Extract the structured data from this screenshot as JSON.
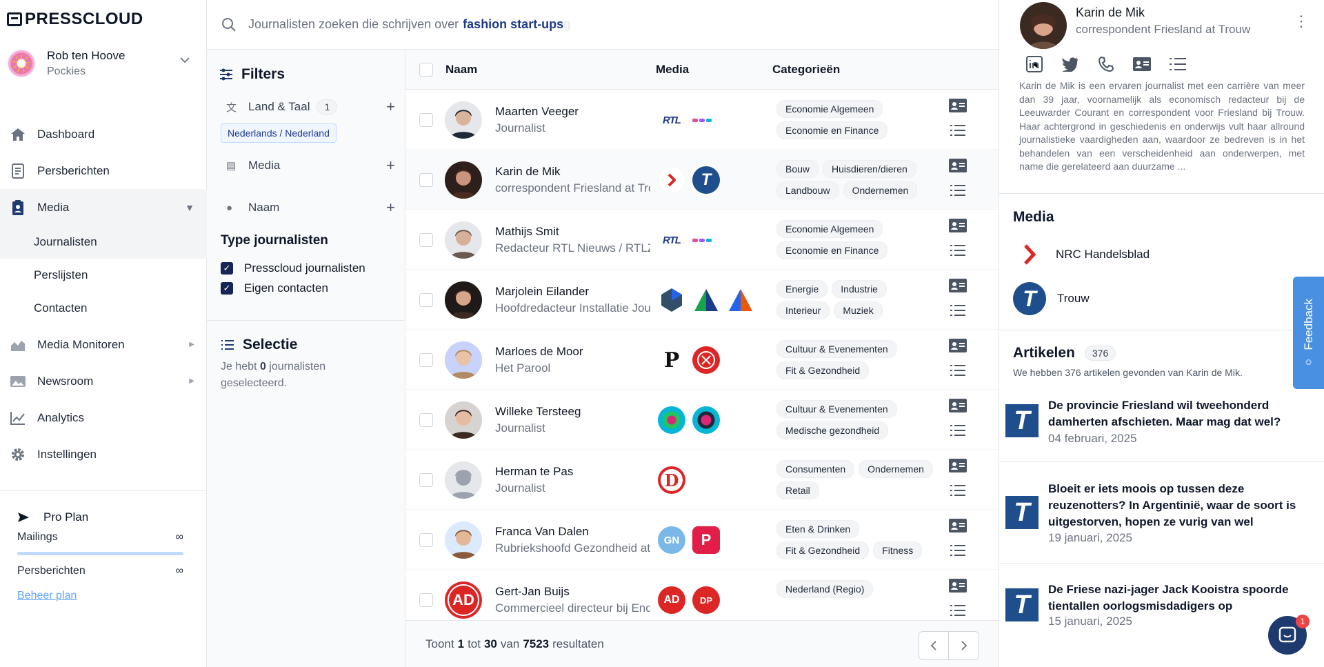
{
  "app": {
    "logo": "PRESSCLOUD"
  },
  "user": {
    "name": "Rob ten Hoove",
    "org": "Pockies"
  },
  "nav": {
    "dashboard": "Dashboard",
    "persberichten": "Persberichten",
    "media": "Media",
    "journalisten": "Journalisten",
    "perslijsten": "Perslijsten",
    "contacten": "Contacten",
    "media_monitoren": "Media Monitoren",
    "newsroom": "Newsroom",
    "analytics": "Analytics",
    "instellingen": "Instellingen"
  },
  "plan": {
    "name": "Pro Plan",
    "mailings_label": "Mailings",
    "mailings_value": "∞",
    "mailings_usage": 1.0,
    "persberichten_label": "Persberichten",
    "persberichten_value": "∞",
    "manage_link": "Beheer plan"
  },
  "search": {
    "prefix": "Journalisten zoeken die schrijven over",
    "highlight": "fashion start-ups",
    "caret": "g"
  },
  "filters": {
    "title": "Filters",
    "land_taal": "Land & Taal",
    "land_taal_count": "1",
    "land_taal_chip": "Nederlands / Nederland",
    "media": "Media",
    "naam": "Naam",
    "type_title": "Type journalisten",
    "presscloud": "Presscloud journalisten",
    "eigen": "Eigen contacten"
  },
  "selection": {
    "title": "Selectie",
    "text_pre": "Je hebt ",
    "count": "0",
    "text_post": " journalisten geselecteerd."
  },
  "table": {
    "headers": {
      "name": "Naam",
      "media": "Media",
      "categories": "Categorieën"
    },
    "rows": [
      {
        "name": "Maarten Veeger",
        "role": "Journalist",
        "tags": [
          "Economie Algemeen",
          "Economie en Finance"
        ]
      },
      {
        "name": "Karin de Mik",
        "role": "correspondent Friesland at Trouw",
        "tags": [
          "Bouw",
          "Huisdieren/dieren",
          "Landbouw",
          "Ondernemen"
        ]
      },
      {
        "name": "Mathijs Smit",
        "role": "Redacteur RTL Nieuws / RTLZ",
        "tags": [
          "Economie Algemeen",
          "Economie en Finance"
        ]
      },
      {
        "name": "Marjolein Eilander",
        "role": "Hoofdredacteur Installatie Journaal",
        "tags": [
          "Energie",
          "Industrie",
          "Interieur",
          "Muziek"
        ]
      },
      {
        "name": "Marloes de Moor",
        "role": "Het Parool",
        "tags": [
          "Cultuur & Evenementen",
          "Fit & Gezondheid"
        ]
      },
      {
        "name": "Willeke Tersteeg",
        "role": "Journalist",
        "tags": [
          "Cultuur & Evenementen",
          "Medische gezondheid"
        ]
      },
      {
        "name": "Herman te Pas",
        "role": "Journalist",
        "tags": [
          "Consumenten",
          "Ondernemen",
          "Retail"
        ]
      },
      {
        "name": "Franca Van Dalen",
        "role": "Rubriekshoofd Gezondheid at AD",
        "tags": [
          "Eten & Drinken",
          "Fit & Gezondheid",
          "Fitness"
        ]
      },
      {
        "name": "Gert-Jan Buijs",
        "role": "Commercieel directeur bij Endemol",
        "tags": [
          "Nederland (Regio)"
        ]
      }
    ],
    "logos": {
      "rtl": "RTL",
      "trouw": "T",
      "parool": "P",
      "telegraaf": "D",
      "gn": "GN",
      "ad": "AD",
      "dp": "DP",
      "p_logo": "P"
    },
    "footer": {
      "pre": "Toont",
      "from": "1",
      "mid1": "tot",
      "to": "30",
      "mid2": "van",
      "total": "7523",
      "post": "resultaten"
    }
  },
  "panel": {
    "name": "Karin de Mik",
    "role": "correspondent Friesland at Trouw",
    "bio": "Karin de Mik is een ervaren journalist met een carrière van meer dan 39 jaar, voornamelijk als economisch redacteur bij de Leeuwarder Courant en correspondent voor Friesland bij Trouw. Haar achtergrond in geschiedenis en onderwijs vult haar allround journalistieke vaardigheden aan, waardoor ze bedreven is in het behandelen van een verscheidenheid aan onderwerpen, met name die gerelateerd aan duurzame ...",
    "media_title": "Media",
    "media": [
      "NRC Handelsblad",
      "Trouw"
    ],
    "articles_title": "Artikelen",
    "articles_count": "376",
    "articles_sub": "We hebben 376 artikelen gevonden van Karin de Mik.",
    "articles": [
      {
        "title": "De provincie Friesland wil tweehonderd damherten afschieten. Maar mag dat wel?",
        "date": "04 februari, 2025"
      },
      {
        "title": "Bloeit er iets moois op tussen deze reuzenotters? In Argentinië, waar de soort is uitgestorven, hopen ze vurig van wel",
        "date": "19 januari, 2025"
      },
      {
        "title": "De Friese nazi-jager Jack Kooistra spoorde tientallen oorlogsmisdadigers op",
        "date": "15 januari, 2025"
      }
    ]
  },
  "feedback": {
    "label": "Feedback"
  },
  "chat": {
    "badge": "1"
  },
  "colors": {
    "accent": "#172554",
    "link": "#60a5fa",
    "trouw": "#1e4e8c",
    "nrc": "#dc2626",
    "feedback": "#4a90e2"
  }
}
